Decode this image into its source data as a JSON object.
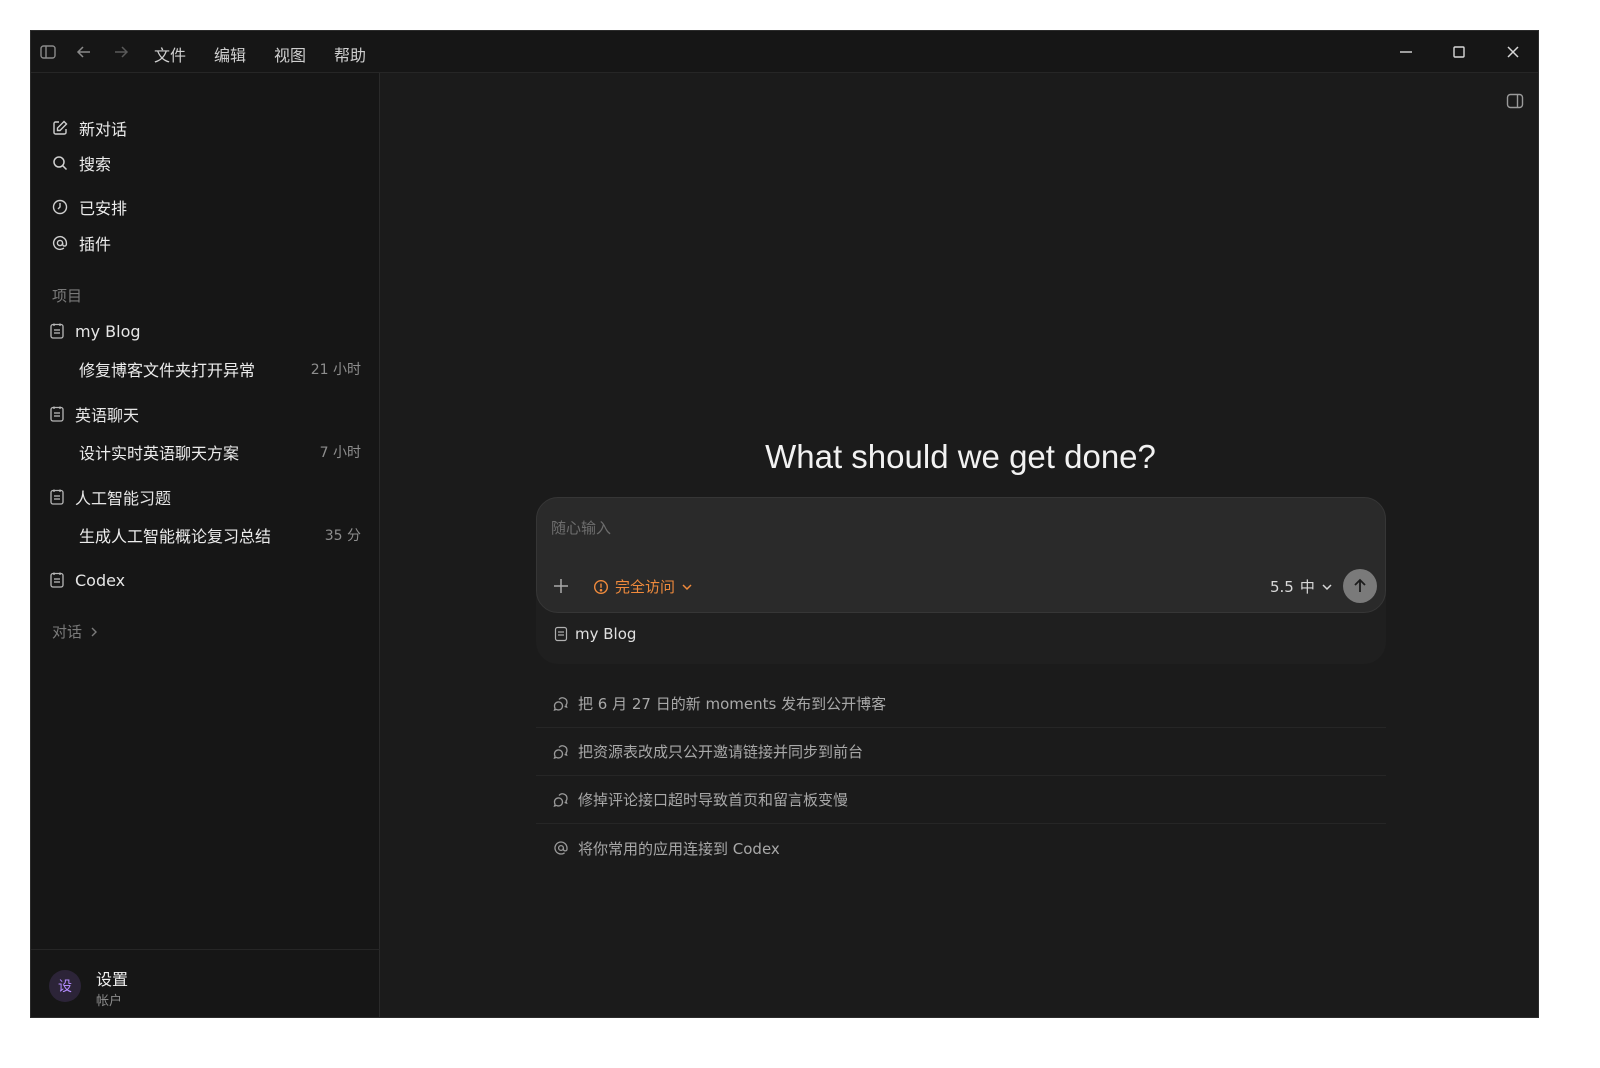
{
  "menu": [
    "文件",
    "编辑",
    "视图",
    "帮助"
  ],
  "sidebar": {
    "nav": [
      {
        "label": "新对话",
        "icon": "edit-icon"
      },
      {
        "label": "搜索",
        "icon": "search-icon"
      },
      {
        "label": "已安排",
        "icon": "clock-icon"
      },
      {
        "label": "插件",
        "icon": "at-icon"
      }
    ],
    "projects_label": "项目",
    "projects": [
      {
        "name": "my Blog",
        "thread": {
          "title": "修复博客文件夹打开异常",
          "time": "21 小时"
        }
      },
      {
        "name": "英语聊天",
        "thread": {
          "title": "设计实时英语聊天方案",
          "time": "7 小时"
        }
      },
      {
        "name": "人工智能习题",
        "thread": {
          "title": "生成人工智能概论复习总结",
          "time": "35 分"
        }
      },
      {
        "name": "Codex"
      }
    ],
    "conversations_label": "对话",
    "footer": {
      "avatar": "设",
      "title": "设置",
      "subtitle": "帐户"
    }
  },
  "main": {
    "headline": "What should we get done?",
    "composer": {
      "placeholder": "随心输入",
      "access": "完全访问",
      "model": "5.5",
      "effort": "中",
      "project": "my Blog"
    },
    "suggestions": [
      "把 6 月 27 日的新 moments 发布到公开博客",
      "把资源表改成只公开邀请链接并同步到前台",
      "修掉评论接口超时导致首页和留言板变慢",
      "将你常用的应用连接到 Codex"
    ]
  },
  "colors": {
    "accent": "#f08a3c",
    "background": "#1b1b1b",
    "sidebar": "#161616"
  }
}
